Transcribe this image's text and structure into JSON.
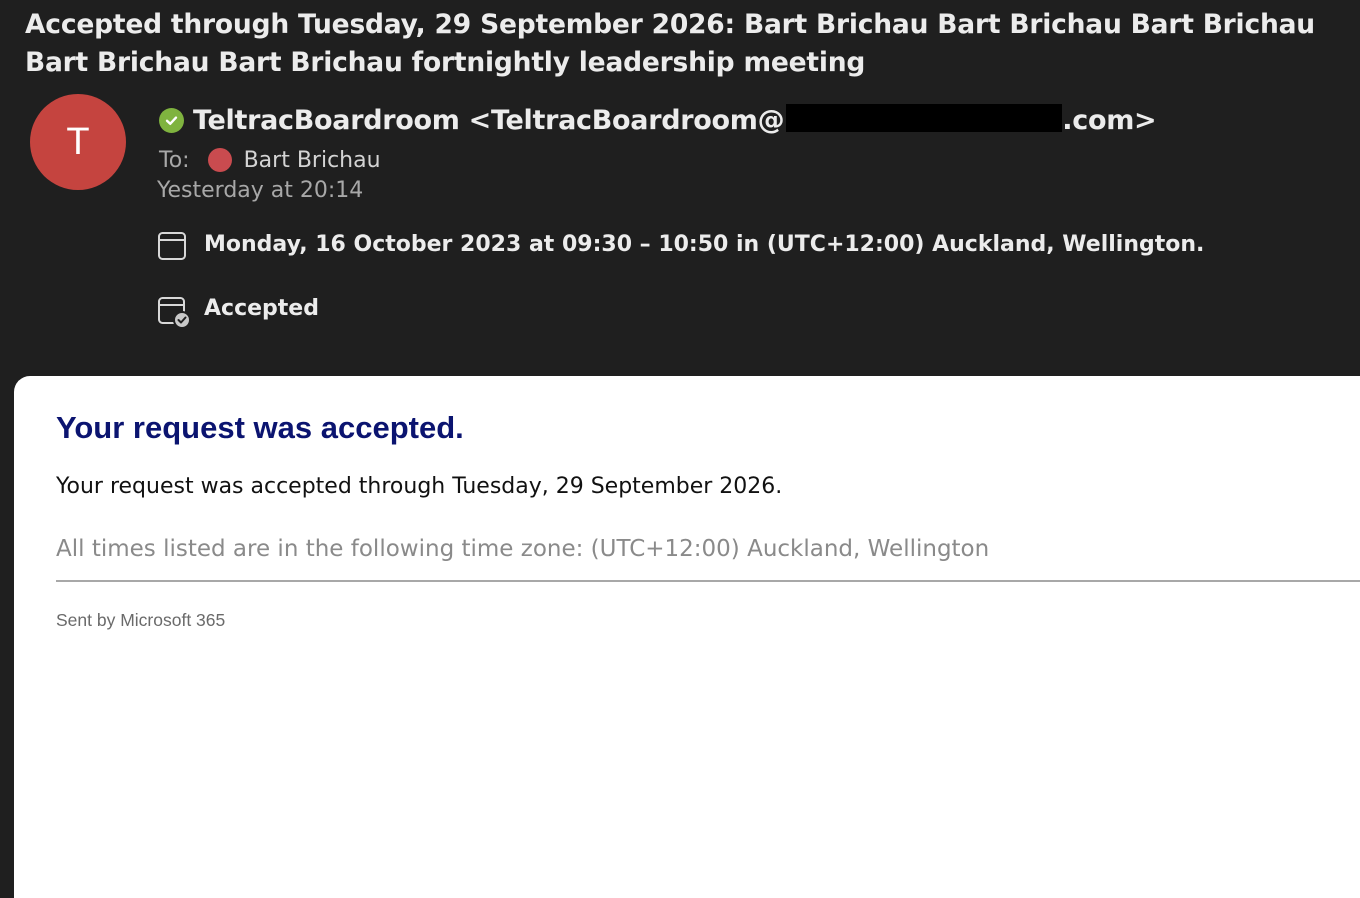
{
  "subject": "Accepted through Tuesday, 29 September 2026: Bart Brichau Bart Brichau Bart Brichau Bart Brichau Bart Brichau fortnightly leadership meeting",
  "sender": {
    "initial": "T",
    "avatar_color": "#c5443f",
    "verified_color": "#7fb33f",
    "display_prefix": "TeltracBoardroom <TeltracBoardroom@",
    "display_suffix": ".com>"
  },
  "recipients": {
    "label": "To:",
    "name": "Bart Brichau",
    "dot_color": "#c94b4f"
  },
  "date": "Yesterday at 20:14",
  "event": {
    "time": "Monday, 16 October 2023 at 09:30 – 10:50 in (UTC+12:00) Auckland, Wellington.",
    "status": "Accepted"
  },
  "body": {
    "title": "Your request was accepted.",
    "title_color": "#0b1470",
    "message": "Your request was accepted through Tuesday, 29 September 2026.",
    "timezone_note": "All times listed are in the following time zone: (UTC+12:00) Auckland, Wellington",
    "footer": "Sent by Microsoft 365"
  }
}
